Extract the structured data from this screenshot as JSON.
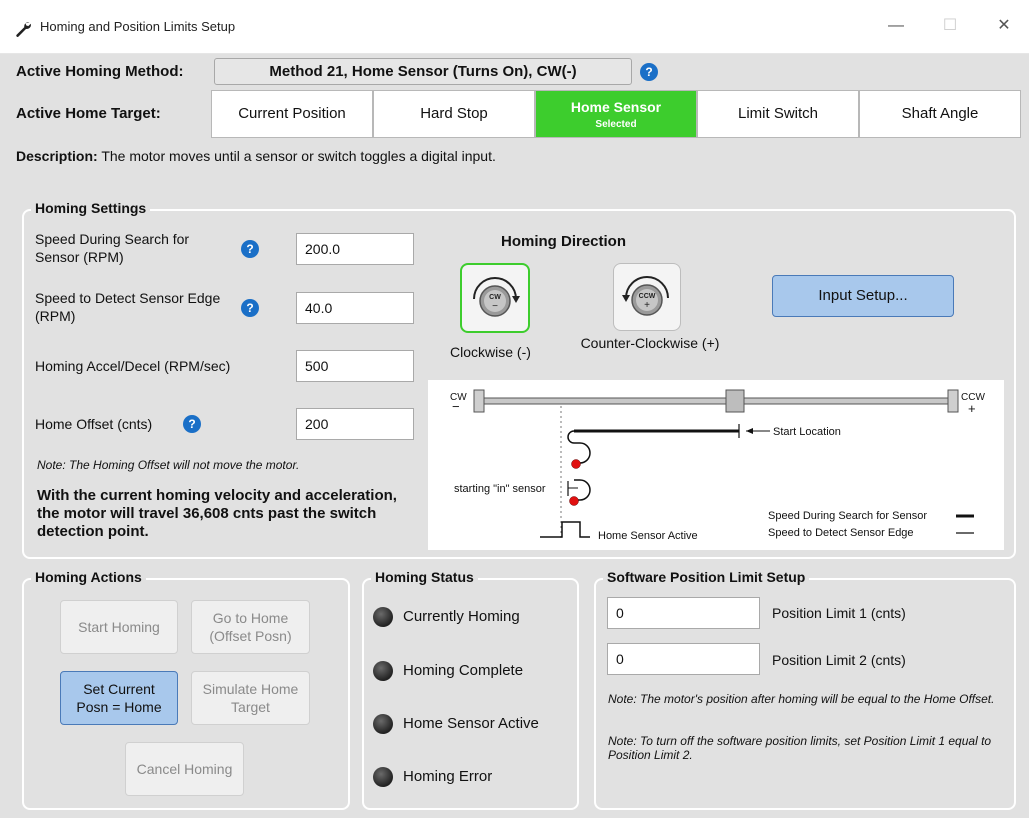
{
  "window": {
    "title": "Homing and Position Limits Setup"
  },
  "header": {
    "method_label": "Active Homing Method:",
    "method_value": "Method 21, Home Sensor (Turns On), CW(-)",
    "target_label": "Active Home Target:",
    "targets": [
      {
        "label": "Current Position"
      },
      {
        "label": "Hard Stop"
      },
      {
        "label": "Home Sensor",
        "sub": "Selected"
      },
      {
        "label": "Limit Switch"
      },
      {
        "label": "Shaft Angle"
      }
    ],
    "description_label": "Description:",
    "description": "The motor moves until a sensor or switch toggles a digital input."
  },
  "homing_settings": {
    "title": "Homing Settings",
    "fields": [
      {
        "label": "Speed During Search for Sensor (RPM)",
        "value": "200.0"
      },
      {
        "label": "Speed to Detect Sensor Edge (RPM)",
        "value": "40.0"
      },
      {
        "label": "Homing Accel/Decel (RPM/sec)",
        "value": "500"
      },
      {
        "label": "Home Offset (cnts)",
        "value": "200"
      }
    ],
    "note": "Note: The Homing Offset will not move the motor.",
    "travel_text": "With the current homing velocity and acceleration, the motor will travel 36,608 cnts past the switch detection point.",
    "direction_title": "Homing Direction",
    "cw_label": "Clockwise (-)",
    "ccw_label": "Counter-Clockwise (+)",
    "cw_glyph": "CW",
    "ccw_glyph": "CCW",
    "input_setup": "Input Setup...",
    "diagram": {
      "cw": "CW",
      "ccw": "CCW",
      "minus": "−",
      "plus": "+",
      "start_location": "Start Location",
      "starting_in_sensor": "starting \"in\" sensor",
      "home_sensor_active": "Home Sensor Active",
      "legend_search": "Speed During Search for Sensor",
      "legend_detect": "Speed to Detect Sensor Edge"
    }
  },
  "homing_actions": {
    "title": "Homing Actions",
    "start": "Start Homing",
    "goto_home": "Go to Home (Offset Posn)",
    "set_current": "Set Current Posn = Home",
    "simulate": "Simulate Home Target",
    "cancel": "Cancel Homing"
  },
  "homing_status": {
    "title": "Homing Status",
    "items": [
      "Currently Homing",
      "Homing Complete",
      "Home Sensor Active",
      "Homing Error"
    ]
  },
  "position_limits": {
    "title": "Software Position Limit Setup",
    "limit1_value": "0",
    "limit1_label": "Position Limit 1 (cnts)",
    "limit2_value": "0",
    "limit2_label": "Position Limit 2 (cnts)",
    "note1": "Note: The motor's position after homing will be equal to the Home Offset.",
    "note2": "Note: To turn off the software position limits, set Position Limit 1 equal to Position Limit 2."
  },
  "colors": {
    "selected_green": "#3dcd2d",
    "help_blue": "#1a6fc7",
    "button_blue": "#a8c8ec"
  },
  "icons": [
    "wrench-icon",
    "help-icon",
    "cw-rotation-icon",
    "ccw-rotation-icon",
    "led-indicator"
  ]
}
